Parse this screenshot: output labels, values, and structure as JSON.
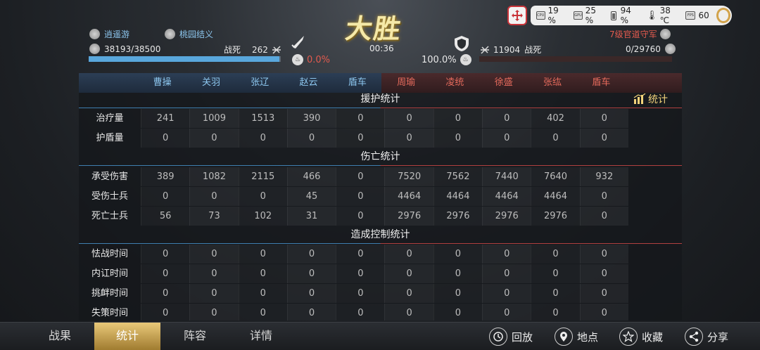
{
  "status_bar": {
    "cpu": "19 %",
    "gpu": "25 %",
    "battery": "94 %",
    "temperature": "38 ℃",
    "fps": "60",
    "fps_label": "FPS"
  },
  "battle": {
    "result_title": "大胜",
    "timer": "00:36"
  },
  "left_player": {
    "name": "逍遥游",
    "team": "桃园结义",
    "troops": "38193/38500",
    "killed_label": "战死",
    "killed": "262",
    "morale": "0.0%",
    "hp_fraction": 0.992
  },
  "right_player": {
    "name": "7级官道守军",
    "killed": "11904",
    "killed_label": "战死",
    "troops": "0/29760",
    "morale": "100.0%",
    "hp_fraction": 0.0
  },
  "columns": {
    "left": [
      "曹操",
      "关羽",
      "张辽",
      "赵云",
      "盾车"
    ],
    "right": [
      "周瑜",
      "凌统",
      "徐盛",
      "张纮",
      "盾车"
    ]
  },
  "sections": [
    {
      "title": "援护统计",
      "rows": [
        {
          "label": "治疗量",
          "values": [
            "241",
            "1009",
            "1513",
            "390",
            "0",
            "0",
            "0",
            "0",
            "402",
            "0"
          ]
        },
        {
          "label": "护盾量",
          "values": [
            "0",
            "0",
            "0",
            "0",
            "0",
            "0",
            "0",
            "0",
            "0",
            "0"
          ]
        }
      ]
    },
    {
      "title": "伤亡统计",
      "rows": [
        {
          "label": "承受伤害",
          "values": [
            "389",
            "1082",
            "2115",
            "466",
            "0",
            "7520",
            "7562",
            "7440",
            "7640",
            "932"
          ]
        },
        {
          "label": "受伤士兵",
          "values": [
            "0",
            "0",
            "0",
            "45",
            "0",
            "4464",
            "4464",
            "4464",
            "4464",
            "0"
          ]
        },
        {
          "label": "死亡士兵",
          "values": [
            "56",
            "73",
            "102",
            "31",
            "0",
            "2976",
            "2976",
            "2976",
            "2976",
            "0"
          ]
        }
      ]
    },
    {
      "title": "造成控制统计",
      "rows": [
        {
          "label": "怯战时间",
          "values": [
            "0",
            "0",
            "0",
            "0",
            "0",
            "0",
            "0",
            "0",
            "0",
            "0"
          ]
        },
        {
          "label": "内讧时间",
          "values": [
            "0",
            "0",
            "0",
            "0",
            "0",
            "0",
            "0",
            "0",
            "0",
            "0"
          ]
        },
        {
          "label": "挑衅时间",
          "values": [
            "0",
            "0",
            "0",
            "0",
            "0",
            "0",
            "0",
            "0",
            "0",
            "0"
          ]
        },
        {
          "label": "失策时间",
          "values": [
            "0",
            "0",
            "0",
            "0",
            "0",
            "0",
            "0",
            "0",
            "0",
            "0"
          ]
        }
      ]
    }
  ],
  "stats_link": "统计",
  "tabs": [
    "战果",
    "统计",
    "阵容",
    "详情"
  ],
  "active_tab": "统计",
  "actions": {
    "replay": "回放",
    "location": "地点",
    "favorite": "收藏",
    "share": "分享"
  },
  "colors": {
    "left_team": "#8cc6ee",
    "right_team": "#e56a5c",
    "active_tab": "#d7b360"
  }
}
